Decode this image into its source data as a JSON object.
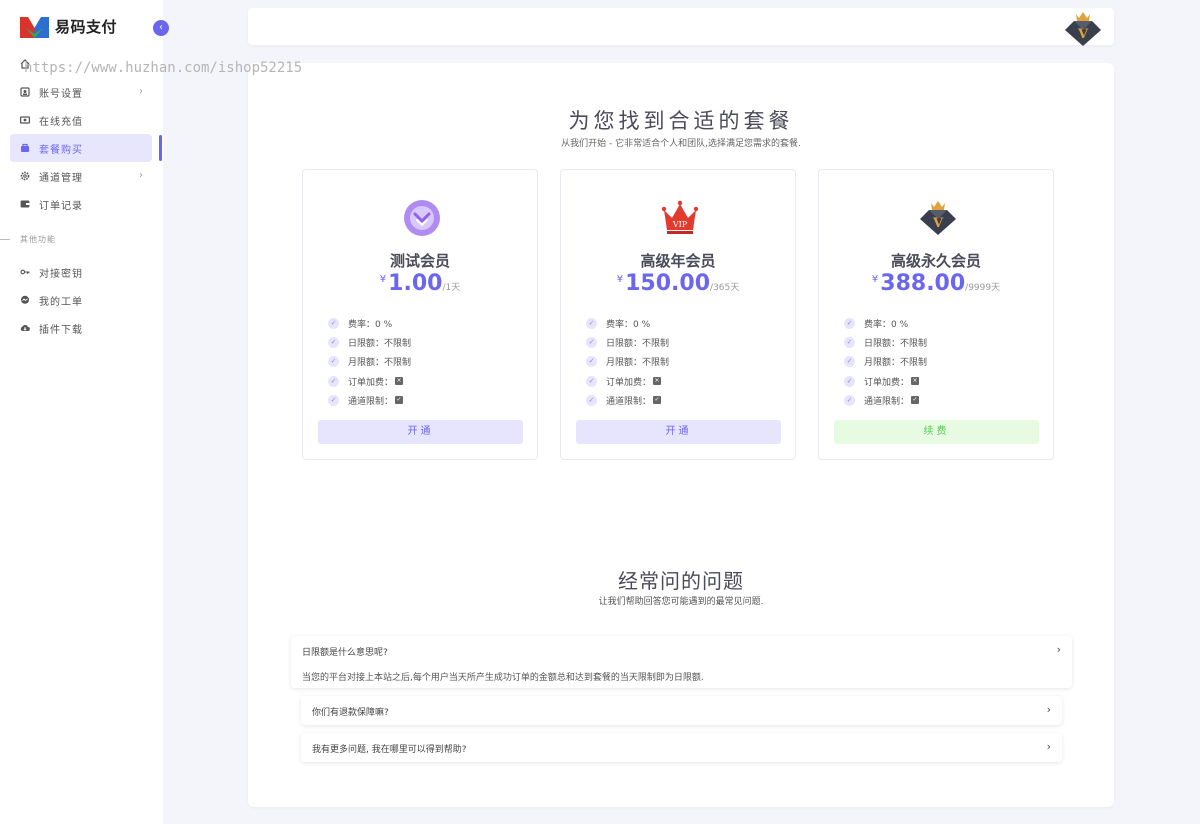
{
  "brand": {
    "name": "易码支付"
  },
  "watermark": "https://www.huzhan.com/ishop52215",
  "sidebar": {
    "items": [
      {
        "label": "",
        "icon": "home-icon"
      },
      {
        "label": "账号设置",
        "icon": "account-icon"
      },
      {
        "label": "在线充值",
        "icon": "recharge-icon"
      },
      {
        "label": "套餐购买",
        "icon": "package-icon",
        "active": true
      },
      {
        "label": "通道管理",
        "icon": "gear-icon"
      },
      {
        "label": "订单记录",
        "icon": "wallet-icon"
      }
    ],
    "section_label": "其他功能",
    "items2": [
      {
        "label": "对接密钥",
        "icon": "key-icon"
      },
      {
        "label": "我的工单",
        "icon": "chat-icon"
      },
      {
        "label": "插件下载",
        "icon": "cloud-download-icon"
      }
    ]
  },
  "main": {
    "title": "为您找到合适的套餐",
    "subtitle": "从我们开始 - 它非常适合个人和团队,选择满足您需求的套餐."
  },
  "plans": [
    {
      "name": "测试会员",
      "currency": "¥",
      "price": "1.00",
      "period": "/1天",
      "features": [
        "费率：0 %",
        "日限额：不限制",
        "月限额：不限制",
        "订单加费：",
        "通道限制："
      ],
      "button": "开通"
    },
    {
      "name": "高级年会员",
      "currency": "¥",
      "price": "150.00",
      "period": "/365天",
      "features": [
        "费率：0 %",
        "日限额：不限制",
        "月限额：不限制",
        "订单加费：",
        "通道限制："
      ],
      "button": "开通"
    },
    {
      "name": "高级永久会员",
      "currency": "¥",
      "price": "388.00",
      "period": "/9999天",
      "features": [
        "费率：0 %",
        "日限额：不限制",
        "月限额：不限制",
        "订单加费：",
        "通道限制："
      ],
      "button": "续费"
    }
  ],
  "faq": {
    "title": "经常问的问题",
    "subtitle": "让我们帮助回答您可能遇到的最常见问题.",
    "items": [
      {
        "q": "日限额是什么意思呢?",
        "a": "当您的平台对接上本站之后,每个用户当天所产生成功订单的金额总和达到套餐的当天限制即为日限额."
      },
      {
        "q": "你们有退款保障嘛?"
      },
      {
        "q": "我有更多问题, 我在哪里可以得到帮助?"
      }
    ]
  },
  "colors": {
    "accent": "#6b66f0",
    "renew": "#5cc55a"
  }
}
